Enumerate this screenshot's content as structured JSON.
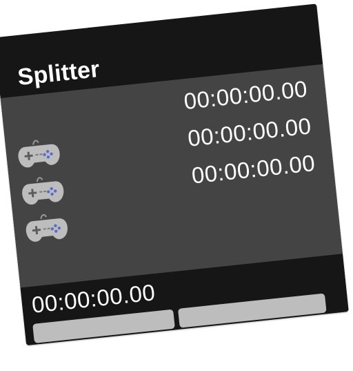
{
  "app": {
    "title": "Splitter"
  },
  "splits": [
    {
      "time": "00:00:00.00",
      "icon": "gamepad-icon"
    },
    {
      "time": "00:00:00.00",
      "icon": "gamepad-icon"
    },
    {
      "time": "00:00:00.00",
      "icon": "gamepad-icon"
    }
  ],
  "timer": {
    "time": "00:00:00.00"
  },
  "buttons": {
    "left_label": "",
    "right_label": ""
  },
  "colors": {
    "window_bg": "#161616",
    "panel_bg": "#444444",
    "text": "#ffffff",
    "button_bg": "#bdbdbd",
    "gamepad_body": "#bdbdbd",
    "gamepad_buttons": "#5a6cc8"
  }
}
